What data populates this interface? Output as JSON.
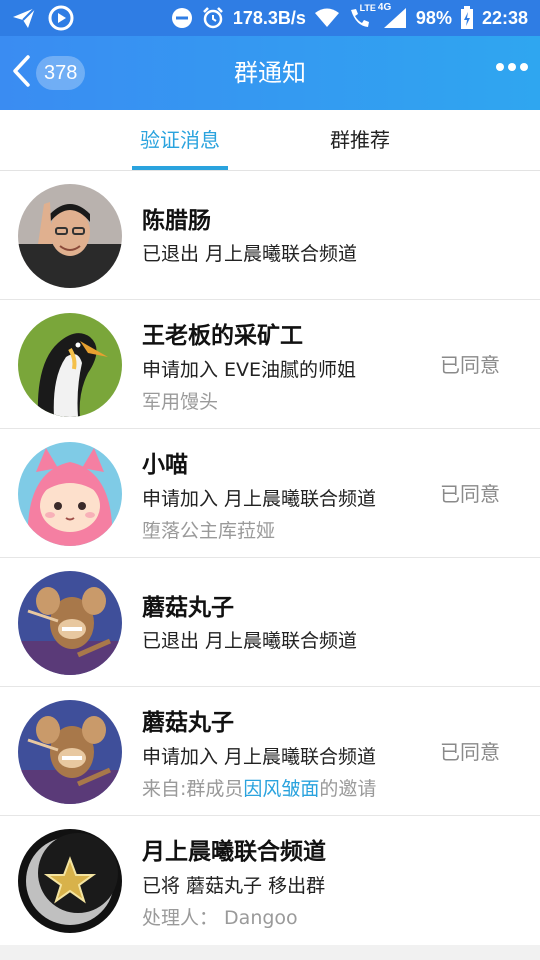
{
  "status_bar": {
    "network_speed": "178.3B/s",
    "network_type": "4G",
    "lte_label": "LTE",
    "battery": "98%",
    "time": "22:38",
    "icons": [
      "send-icon",
      "play-circle-icon",
      "do-not-disturb-icon",
      "alarm-icon",
      "wifi-icon",
      "phone-lte-icon",
      "signal-icon",
      "battery-icon"
    ]
  },
  "header": {
    "back_count": "378",
    "title": "群通知"
  },
  "tabs": [
    {
      "label": "验证消息",
      "active": true
    },
    {
      "label": "群推荐",
      "active": false
    }
  ],
  "notifications": [
    {
      "name": "陈腊肠",
      "message": "已退出 月上晨曦联合频道",
      "sub": "",
      "status": ""
    },
    {
      "name": "王老板的采矿工",
      "message": "申请加入 EVE油腻的师姐",
      "sub": "军用馒头",
      "status": "已同意"
    },
    {
      "name": "小喵",
      "message": "申请加入 月上晨曦联合频道",
      "sub": "堕落公主库菈娅",
      "status": "已同意"
    },
    {
      "name": "蘑菇丸子",
      "message": "已退出 月上晨曦联合频道",
      "sub": "",
      "status": ""
    },
    {
      "name": "蘑菇丸子",
      "message": "申请加入 月上晨曦联合频道",
      "sub_prefix": "来自:群成员",
      "sub_link": "因风皱面",
      "sub_suffix": "的邀请",
      "status": "已同意"
    },
    {
      "name": "月上晨曦联合频道",
      "message": "已将 蘑菇丸子 移出群",
      "sub": "处理人： Dangoo",
      "status": ""
    }
  ],
  "colors": {
    "accent": "#2aa3de",
    "header_start": "#3a8cf2",
    "header_end": "#2fa6f0",
    "status_text": "#8a8a8a"
  }
}
